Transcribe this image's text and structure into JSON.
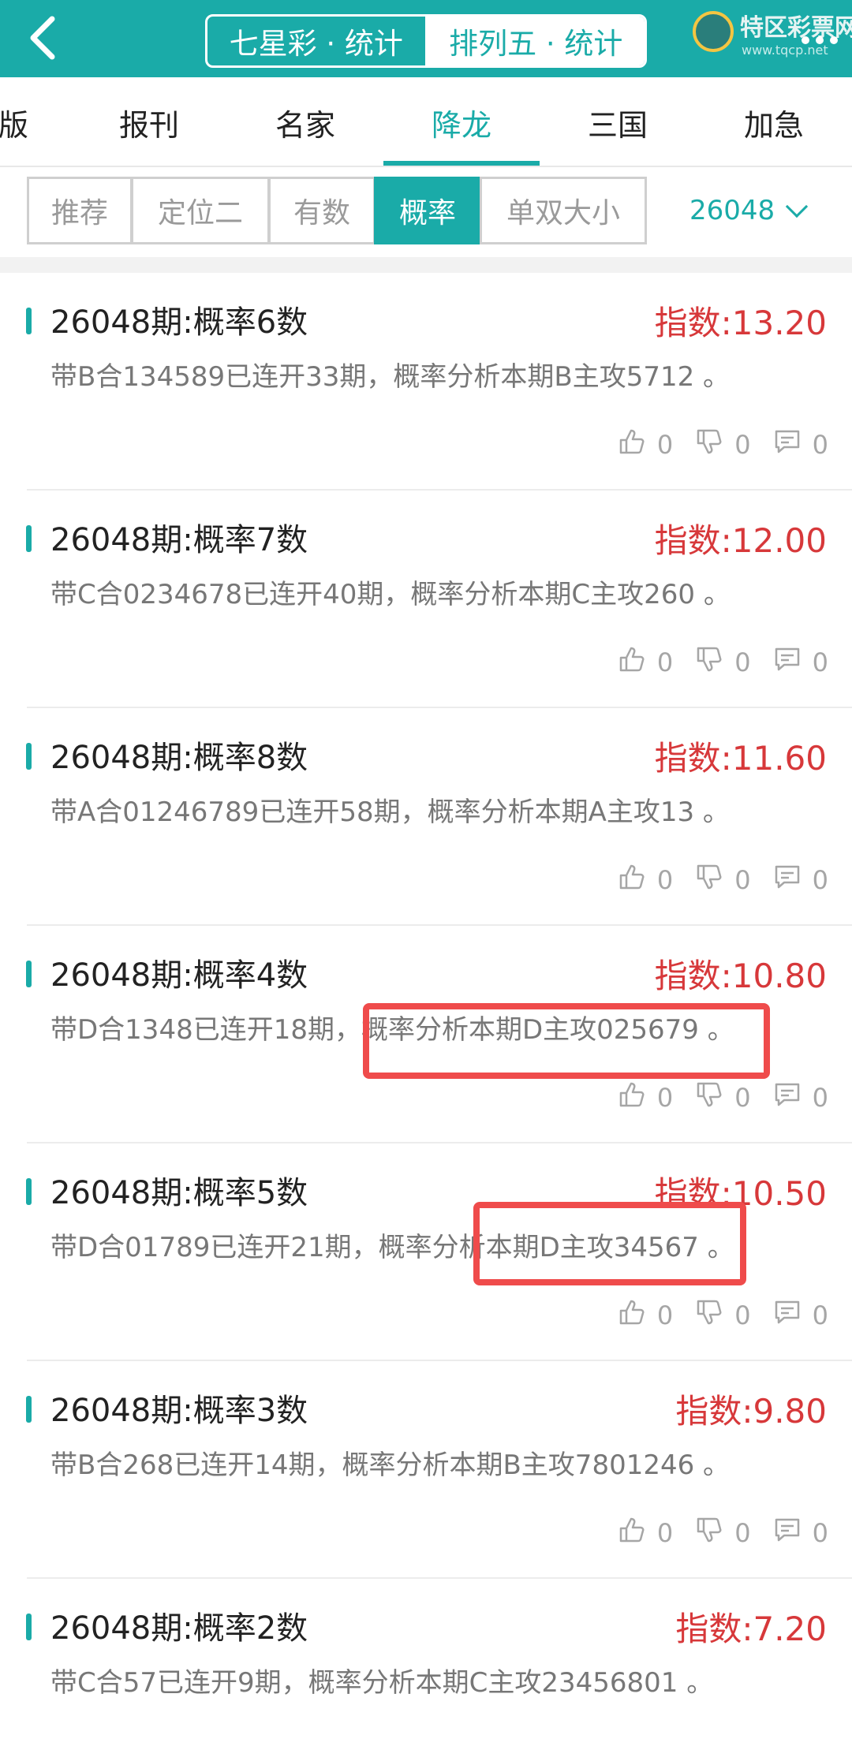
{
  "header": {
    "segments": [
      "七星彩 · 统计",
      "排列五 · 统计"
    ],
    "logo_text": "特区彩票网",
    "logo_url": "www.tqcp.net"
  },
  "tabs": [
    "版",
    "报刊",
    "名家",
    "降龙",
    "三国",
    "加急"
  ],
  "active_tab": "降龙",
  "filters": {
    "chips": [
      "推荐",
      "定位二",
      "有数",
      "概率",
      "单双大小"
    ],
    "active": "概率",
    "issue": "26048"
  },
  "colors": {
    "accent": "#1aaba8",
    "index_red": "#d7383a",
    "highlight": "#ef4b4b"
  },
  "cards": [
    {
      "title": "26048期:概率6数",
      "index": "指数:13.20",
      "desc": "带B合134589已连开33期，概率分析本期B主攻5712 。",
      "likes": "0",
      "dislikes": "0",
      "comments": "0"
    },
    {
      "title": "26048期:概率7数",
      "index": "指数:12.00",
      "desc": "带C合0234678已连开40期，概率分析本期C主攻260 。",
      "likes": "0",
      "dislikes": "0",
      "comments": "0"
    },
    {
      "title": "26048期:概率8数",
      "index": "指数:11.60",
      "desc": "带A合01246789已连开58期，概率分析本期A主攻13 。",
      "likes": "0",
      "dislikes": "0",
      "comments": "0"
    },
    {
      "title": "26048期:概率4数",
      "index": "指数:10.80",
      "desc": "带D合1348已连开18期，概率分析本期D主攻025679 。",
      "likes": "0",
      "dislikes": "0",
      "comments": "0"
    },
    {
      "title": "26048期:概率5数",
      "index": "指数:10.50",
      "desc": "带D合01789已连开21期，概率分析本期D主攻34567 。",
      "likes": "0",
      "dislikes": "0",
      "comments": "0"
    },
    {
      "title": "26048期:概率3数",
      "index": "指数:9.80",
      "desc": "带B合268已连开14期，概率分析本期B主攻7801246 。",
      "likes": "0",
      "dislikes": "0",
      "comments": "0"
    },
    {
      "title": "26048期:概率2数",
      "index": "指数:7.20",
      "desc": "带C合57已连开9期，概率分析本期C主攻23456801 。"
    }
  ]
}
